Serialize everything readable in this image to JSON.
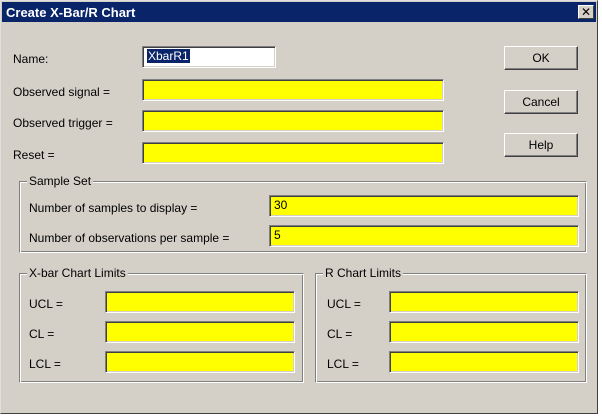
{
  "window": {
    "title": "Create X-Bar/R Chart",
    "close_glyph": "✕"
  },
  "form": {
    "name_label": "Name:",
    "name_value": "XbarR1",
    "observed_signal_label": "Observed signal =",
    "observed_signal_value": "",
    "observed_trigger_label": "Observed trigger =",
    "observed_trigger_value": "",
    "reset_label": "Reset =",
    "reset_value": ""
  },
  "buttons": {
    "ok": "OK",
    "cancel": "Cancel",
    "help": "Help"
  },
  "sample_set": {
    "legend": "Sample Set",
    "samples_label": "Number of samples to display =",
    "samples_value": "30",
    "observations_label": "Number of observations per sample =",
    "observations_value": "5"
  },
  "xbar_limits": {
    "legend": "X-bar Chart Limits",
    "ucl_label": "UCL =",
    "ucl_value": "",
    "cl_label": "CL =",
    "cl_value": "",
    "lcl_label": "LCL =",
    "lcl_value": ""
  },
  "r_limits": {
    "legend": "R Chart Limits",
    "ucl_label": "UCL =",
    "ucl_value": "",
    "cl_label": "CL =",
    "cl_value": "",
    "lcl_label": "LCL =",
    "lcl_value": ""
  },
  "colors": {
    "field_bg": "#ffff00",
    "titlebar_bg": "#0a246a",
    "dialog_bg": "#d4d0c8"
  }
}
